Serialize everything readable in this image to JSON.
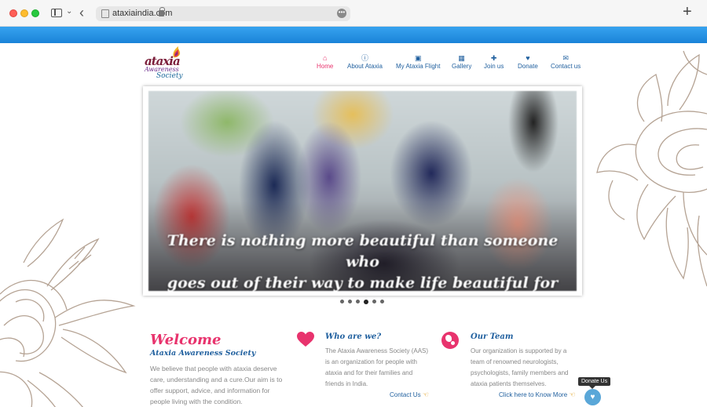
{
  "browser": {
    "url": "ataxiaindia.com"
  },
  "logo": {
    "word": "ataxia",
    "line1": "Awareness",
    "line2": "Society"
  },
  "nav": [
    {
      "label": "Home",
      "icon": "home-icon",
      "active": true
    },
    {
      "label": "About Ataxia",
      "icon": "info-icon",
      "active": false
    },
    {
      "label": "My Ataxia Flight",
      "icon": "inbox-icon",
      "active": false
    },
    {
      "label": "Gallery",
      "icon": "gallery-icon",
      "active": false
    },
    {
      "label": "Join us",
      "icon": "plus-icon",
      "active": false
    },
    {
      "label": "Donate",
      "icon": "heart-icon",
      "active": false
    },
    {
      "label": "Contact us",
      "icon": "envelope-icon",
      "active": false
    }
  ],
  "slider": {
    "quote_line1": "There is nothing more beautiful than someone who",
    "quote_line2": "goes out of their way to make life beautiful for others.",
    "slide_count": 6,
    "active_index": 3
  },
  "welcome": {
    "title": "Welcome",
    "subtitle": "Ataxia Awareness Society",
    "text": "We believe that people with ataxia deserve care, understanding and a cure.Our aim is to offer support, advice, and information for people living with the condition."
  },
  "who": {
    "title": "Who are we?",
    "text": "The Ataxia Awareness Society (AAS) is an organization for people with ataxia and for their families and friends in India.",
    "link": "Contact Us"
  },
  "team": {
    "title": "Our Team",
    "text": "Our organization is supported by a team of renowned neurologists, psychologists, family members and ataxia patients themselves.",
    "link": "Click here to Know More"
  },
  "donate": {
    "tooltip": "Donate Us"
  },
  "colors": {
    "accent_pink": "#e8336d",
    "nav_blue": "#1f5f9e",
    "topbar_blue": "#2592e2"
  }
}
